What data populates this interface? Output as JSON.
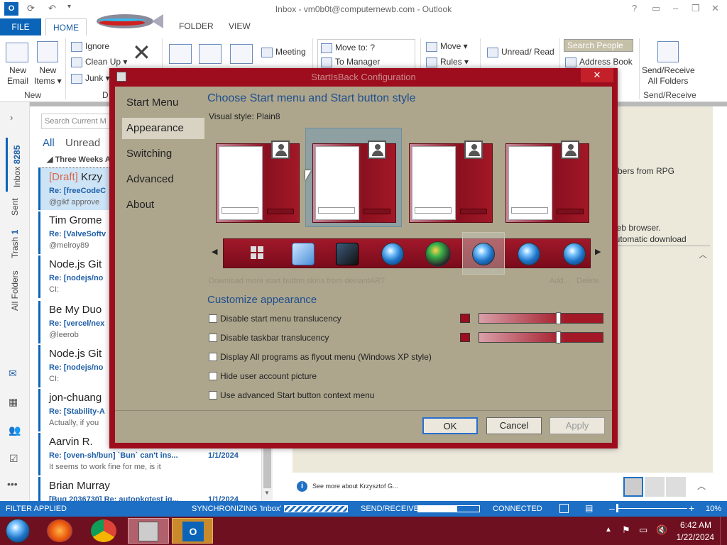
{
  "window": {
    "title": "Inbox - vm0b0t@computernewb.com - Outlook",
    "help": "?",
    "restore": "▭",
    "minimize": "–",
    "maximize": "❐",
    "close": "✕"
  },
  "tabs": {
    "file": "FILE",
    "home": "HOME",
    "folder": "FOLDER",
    "view": "VIEW"
  },
  "ribbon": {
    "new_email": [
      "New",
      "Email"
    ],
    "new_items": [
      "New",
      "Items ▾"
    ],
    "group_new": "New",
    "ignore": "Ignore",
    "clean_up": "Clean Up ▾",
    "junk": "Junk ▾",
    "group_delete_partial": "D",
    "meeting": "Meeting",
    "move_to": "Move to: ?",
    "to_manager": "To Manager",
    "move": "Move ▾",
    "rules": "Rules ▾",
    "unread_read": "Unread/ Read",
    "search_people": "Search People",
    "address_book": "Address Book",
    "send_receive": [
      "Send/Receive",
      "All Folders"
    ],
    "group_send_receive": "Send/Receive"
  },
  "leftnav": {
    "inbox": "Inbox",
    "inbox_count": "8285",
    "sent": "Sent",
    "trash": "Trash",
    "trash_count": "1",
    "all_folders": "All Folders"
  },
  "maillist": {
    "search_placeholder": "Search Current M",
    "filter_all": "All",
    "filter_unread": "Unread",
    "group_header": "Three Weeks A",
    "items": [
      {
        "from_tag": "[Draft]",
        "from": "Krzy",
        "subject": "Re: [freeCodeC",
        "preview": "@gikf approve",
        "date": ""
      },
      {
        "from": "Tim Grome",
        "subject": "Re: [ValveSoftv",
        "preview": "@melroy89",
        "date": ""
      },
      {
        "from": "Node.js Git",
        "subject": "Re: [nodejs/no",
        "preview": "CI:",
        "date": ""
      },
      {
        "from": "Be My Duo",
        "subject": "Re: [vercel/nex",
        "preview": "@leerob",
        "date": ""
      },
      {
        "from": "Node.js Git",
        "subject": "Re: [nodejs/no",
        "preview": "CI:",
        "date": ""
      },
      {
        "from": "jon-chuang",
        "subject": "Re: [Stability-A",
        "preview": "Actually, if you",
        "date": ""
      },
      {
        "from": "Aarvin R.",
        "subject": "Re: [oven-sh/bun] `Bun` can't ins...",
        "preview": "It seems to work fine for me, is it",
        "date": "1/1/2024"
      },
      {
        "from": "Brian Murray",
        "subject": "[Bug 2036730] Re: autopkgtest ig...",
        "preview": "",
        "date": "1/1/2024"
      }
    ]
  },
  "reading": {
    "line1": "mbers from RPG",
    "line2": "web browser.",
    "line3": "automatic download",
    "see_more": "See more about Krzysztof G..."
  },
  "status": {
    "filter": "FILTER APPLIED",
    "sync": "SYNCHRONIZING 'Inbox'",
    "sendrecv": "SEND/RECEIVE",
    "connected": "CONNECTED",
    "zoom": "10%"
  },
  "taskbar": {
    "time": "6:42 AM",
    "date": "1/22/2024"
  },
  "dialog": {
    "title": "StartIsBack Configuration",
    "close": "✕",
    "nav": [
      "Start Menu",
      "Appearance",
      "Switching",
      "Advanced",
      "About"
    ],
    "heading": "Choose Start menu and Start button style",
    "visual_style_label": "Visual style:",
    "visual_style_value": "Plain8",
    "download_link": "Download more start button skins from deviantART",
    "add": "Add...",
    "delete": "Delete",
    "customize_heading": "Customize appearance",
    "options": [
      "Disable start menu translucency",
      "Disable taskbar translucency",
      "Display All programs as flyout menu (Windows XP style)",
      "Hide user account picture",
      "Use advanced Start button context menu"
    ],
    "ok": "OK",
    "cancel": "Cancel",
    "apply": "Apply",
    "start_menu_translucency": 0.64,
    "taskbar_translucency": 0.64
  },
  "colors": {
    "accent": "#0b64b8",
    "dialog_frame": "#9e0d1d",
    "dialog_bg": "#ada68d",
    "taskbar": "#6e1020"
  }
}
